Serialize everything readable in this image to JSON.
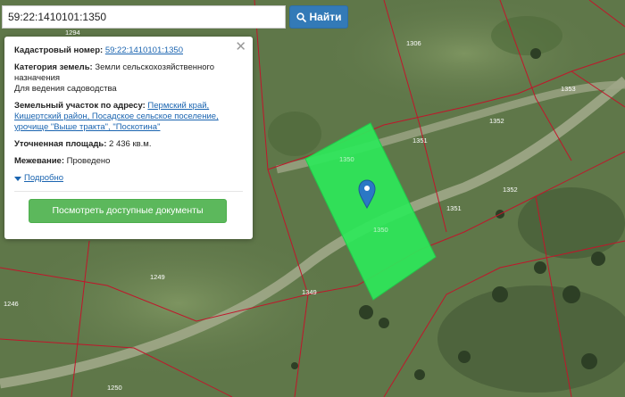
{
  "search": {
    "value": "59:22:1410101:1350",
    "button_label": "Найти"
  },
  "info_panel": {
    "cadastral_label": "Кадастровый номер:",
    "cadastral_number": "59:22:1410101:1350",
    "category_label": "Категория земель:",
    "category_value": "Земли сельскохозяйственного назначения",
    "use_value": "Для ведения садоводства",
    "address_label": "Земельный участок по адресу:",
    "address_value": "Пермский край, Кишертский район, Посадское сельское поселение, урочище \"Выше тракта\", \"Поскотина\"",
    "area_label": "Уточненная площадь:",
    "area_value": "2 436 кв.м.",
    "survey_label": "Межевание:",
    "survey_value": "Проведено",
    "more_link": "Подробно",
    "documents_button": "Посмотреть доступные документы"
  },
  "map": {
    "parcel_labels": {
      "p1306": "1306",
      "p1353": "1353",
      "p1352a": "1352",
      "p1351a": "1351",
      "p1350a": "1350",
      "p1350b": "1350",
      "p1352b": "1352",
      "p1351b": "1351",
      "p1249": "1249",
      "p1349": "1349",
      "p1246": "1246",
      "p1250": "1250",
      "p1294": "1294"
    },
    "highlight_color": "#2ee85a",
    "boundary_color": "#c0162b",
    "marker_color": "#2b78c5"
  }
}
